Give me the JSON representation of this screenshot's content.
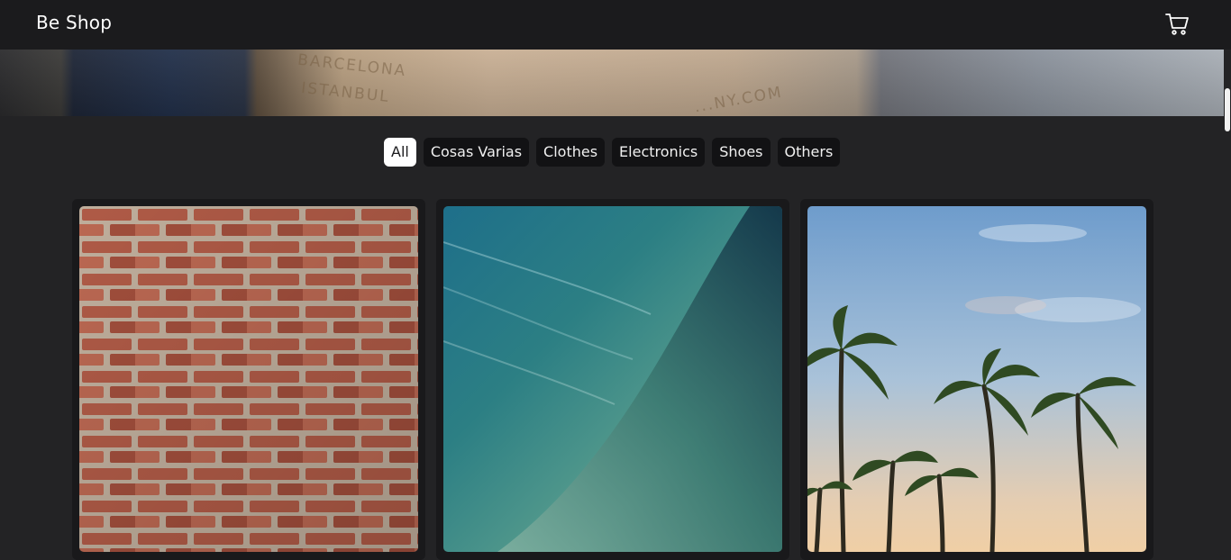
{
  "navbar": {
    "brand": "Be Shop",
    "cart_icon": "shopping-cart-icon"
  },
  "hero": {
    "stamp_line1": "BARCELONA",
    "stamp_line2": "ISTANBUL",
    "stamp_domain": "...NY.COM"
  },
  "filters": [
    {
      "label": "All",
      "active": true
    },
    {
      "label": "Cosas Varias",
      "active": false
    },
    {
      "label": "Clothes",
      "active": false
    },
    {
      "label": "Electronics",
      "active": false
    },
    {
      "label": "Shoes",
      "active": false
    },
    {
      "label": "Others",
      "active": false
    }
  ],
  "products": [
    {
      "image": "brick-wall-photo"
    },
    {
      "image": "ocean-wave-photo"
    },
    {
      "image": "palm-trees-photo"
    }
  ],
  "colors": {
    "navbar": "#1b1b1d",
    "background": "#232325",
    "chip": "#121214",
    "chip_active": "#ffffff",
    "card": "#19191b"
  }
}
